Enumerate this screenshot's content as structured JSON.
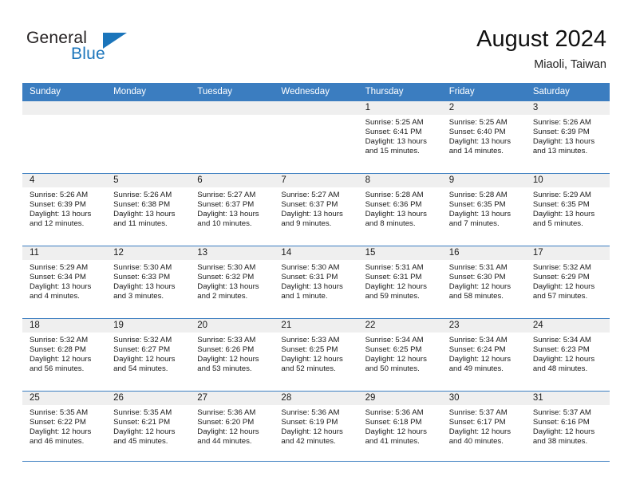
{
  "brand": {
    "name_part1": "General",
    "name_part2": "Blue",
    "logo_color": "#1b75bb",
    "text_color": "#231f20"
  },
  "header": {
    "title": "August 2024",
    "subtitle": "Miaoli, Taiwan"
  },
  "theme": {
    "header_row_bg": "#3b7dc0",
    "header_row_text": "#ffffff",
    "daynum_band_bg": "#efefef",
    "grid_line": "#3b7dc0",
    "cell_bg": "#ffffff",
    "body_text": "#1a1a1a"
  },
  "weekday_headers": [
    "Sunday",
    "Monday",
    "Tuesday",
    "Wednesday",
    "Thursday",
    "Friday",
    "Saturday"
  ],
  "weeks": [
    [
      {
        "day": "",
        "sunrise": "",
        "sunset": "",
        "daylight_line1": "",
        "daylight_line2": ""
      },
      {
        "day": "",
        "sunrise": "",
        "sunset": "",
        "daylight_line1": "",
        "daylight_line2": ""
      },
      {
        "day": "",
        "sunrise": "",
        "sunset": "",
        "daylight_line1": "",
        "daylight_line2": ""
      },
      {
        "day": "",
        "sunrise": "",
        "sunset": "",
        "daylight_line1": "",
        "daylight_line2": ""
      },
      {
        "day": "1",
        "sunrise": "Sunrise: 5:25 AM",
        "sunset": "Sunset: 6:41 PM",
        "daylight_line1": "Daylight: 13 hours",
        "daylight_line2": "and 15 minutes."
      },
      {
        "day": "2",
        "sunrise": "Sunrise: 5:25 AM",
        "sunset": "Sunset: 6:40 PM",
        "daylight_line1": "Daylight: 13 hours",
        "daylight_line2": "and 14 minutes."
      },
      {
        "day": "3",
        "sunrise": "Sunrise: 5:26 AM",
        "sunset": "Sunset: 6:39 PM",
        "daylight_line1": "Daylight: 13 hours",
        "daylight_line2": "and 13 minutes."
      }
    ],
    [
      {
        "day": "4",
        "sunrise": "Sunrise: 5:26 AM",
        "sunset": "Sunset: 6:39 PM",
        "daylight_line1": "Daylight: 13 hours",
        "daylight_line2": "and 12 minutes."
      },
      {
        "day": "5",
        "sunrise": "Sunrise: 5:26 AM",
        "sunset": "Sunset: 6:38 PM",
        "daylight_line1": "Daylight: 13 hours",
        "daylight_line2": "and 11 minutes."
      },
      {
        "day": "6",
        "sunrise": "Sunrise: 5:27 AM",
        "sunset": "Sunset: 6:37 PM",
        "daylight_line1": "Daylight: 13 hours",
        "daylight_line2": "and 10 minutes."
      },
      {
        "day": "7",
        "sunrise": "Sunrise: 5:27 AM",
        "sunset": "Sunset: 6:37 PM",
        "daylight_line1": "Daylight: 13 hours",
        "daylight_line2": "and 9 minutes."
      },
      {
        "day": "8",
        "sunrise": "Sunrise: 5:28 AM",
        "sunset": "Sunset: 6:36 PM",
        "daylight_line1": "Daylight: 13 hours",
        "daylight_line2": "and 8 minutes."
      },
      {
        "day": "9",
        "sunrise": "Sunrise: 5:28 AM",
        "sunset": "Sunset: 6:35 PM",
        "daylight_line1": "Daylight: 13 hours",
        "daylight_line2": "and 7 minutes."
      },
      {
        "day": "10",
        "sunrise": "Sunrise: 5:29 AM",
        "sunset": "Sunset: 6:35 PM",
        "daylight_line1": "Daylight: 13 hours",
        "daylight_line2": "and 5 minutes."
      }
    ],
    [
      {
        "day": "11",
        "sunrise": "Sunrise: 5:29 AM",
        "sunset": "Sunset: 6:34 PM",
        "daylight_line1": "Daylight: 13 hours",
        "daylight_line2": "and 4 minutes."
      },
      {
        "day": "12",
        "sunrise": "Sunrise: 5:30 AM",
        "sunset": "Sunset: 6:33 PM",
        "daylight_line1": "Daylight: 13 hours",
        "daylight_line2": "and 3 minutes."
      },
      {
        "day": "13",
        "sunrise": "Sunrise: 5:30 AM",
        "sunset": "Sunset: 6:32 PM",
        "daylight_line1": "Daylight: 13 hours",
        "daylight_line2": "and 2 minutes."
      },
      {
        "day": "14",
        "sunrise": "Sunrise: 5:30 AM",
        "sunset": "Sunset: 6:31 PM",
        "daylight_line1": "Daylight: 13 hours",
        "daylight_line2": "and 1 minute."
      },
      {
        "day": "15",
        "sunrise": "Sunrise: 5:31 AM",
        "sunset": "Sunset: 6:31 PM",
        "daylight_line1": "Daylight: 12 hours",
        "daylight_line2": "and 59 minutes."
      },
      {
        "day": "16",
        "sunrise": "Sunrise: 5:31 AM",
        "sunset": "Sunset: 6:30 PM",
        "daylight_line1": "Daylight: 12 hours",
        "daylight_line2": "and 58 minutes."
      },
      {
        "day": "17",
        "sunrise": "Sunrise: 5:32 AM",
        "sunset": "Sunset: 6:29 PM",
        "daylight_line1": "Daylight: 12 hours",
        "daylight_line2": "and 57 minutes."
      }
    ],
    [
      {
        "day": "18",
        "sunrise": "Sunrise: 5:32 AM",
        "sunset": "Sunset: 6:28 PM",
        "daylight_line1": "Daylight: 12 hours",
        "daylight_line2": "and 56 minutes."
      },
      {
        "day": "19",
        "sunrise": "Sunrise: 5:32 AM",
        "sunset": "Sunset: 6:27 PM",
        "daylight_line1": "Daylight: 12 hours",
        "daylight_line2": "and 54 minutes."
      },
      {
        "day": "20",
        "sunrise": "Sunrise: 5:33 AM",
        "sunset": "Sunset: 6:26 PM",
        "daylight_line1": "Daylight: 12 hours",
        "daylight_line2": "and 53 minutes."
      },
      {
        "day": "21",
        "sunrise": "Sunrise: 5:33 AM",
        "sunset": "Sunset: 6:25 PM",
        "daylight_line1": "Daylight: 12 hours",
        "daylight_line2": "and 52 minutes."
      },
      {
        "day": "22",
        "sunrise": "Sunrise: 5:34 AM",
        "sunset": "Sunset: 6:25 PM",
        "daylight_line1": "Daylight: 12 hours",
        "daylight_line2": "and 50 minutes."
      },
      {
        "day": "23",
        "sunrise": "Sunrise: 5:34 AM",
        "sunset": "Sunset: 6:24 PM",
        "daylight_line1": "Daylight: 12 hours",
        "daylight_line2": "and 49 minutes."
      },
      {
        "day": "24",
        "sunrise": "Sunrise: 5:34 AM",
        "sunset": "Sunset: 6:23 PM",
        "daylight_line1": "Daylight: 12 hours",
        "daylight_line2": "and 48 minutes."
      }
    ],
    [
      {
        "day": "25",
        "sunrise": "Sunrise: 5:35 AM",
        "sunset": "Sunset: 6:22 PM",
        "daylight_line1": "Daylight: 12 hours",
        "daylight_line2": "and 46 minutes."
      },
      {
        "day": "26",
        "sunrise": "Sunrise: 5:35 AM",
        "sunset": "Sunset: 6:21 PM",
        "daylight_line1": "Daylight: 12 hours",
        "daylight_line2": "and 45 minutes."
      },
      {
        "day": "27",
        "sunrise": "Sunrise: 5:36 AM",
        "sunset": "Sunset: 6:20 PM",
        "daylight_line1": "Daylight: 12 hours",
        "daylight_line2": "and 44 minutes."
      },
      {
        "day": "28",
        "sunrise": "Sunrise: 5:36 AM",
        "sunset": "Sunset: 6:19 PM",
        "daylight_line1": "Daylight: 12 hours",
        "daylight_line2": "and 42 minutes."
      },
      {
        "day": "29",
        "sunrise": "Sunrise: 5:36 AM",
        "sunset": "Sunset: 6:18 PM",
        "daylight_line1": "Daylight: 12 hours",
        "daylight_line2": "and 41 minutes."
      },
      {
        "day": "30",
        "sunrise": "Sunrise: 5:37 AM",
        "sunset": "Sunset: 6:17 PM",
        "daylight_line1": "Daylight: 12 hours",
        "daylight_line2": "and 40 minutes."
      },
      {
        "day": "31",
        "sunrise": "Sunrise: 5:37 AM",
        "sunset": "Sunset: 6:16 PM",
        "daylight_line1": "Daylight: 12 hours",
        "daylight_line2": "and 38 minutes."
      }
    ]
  ]
}
